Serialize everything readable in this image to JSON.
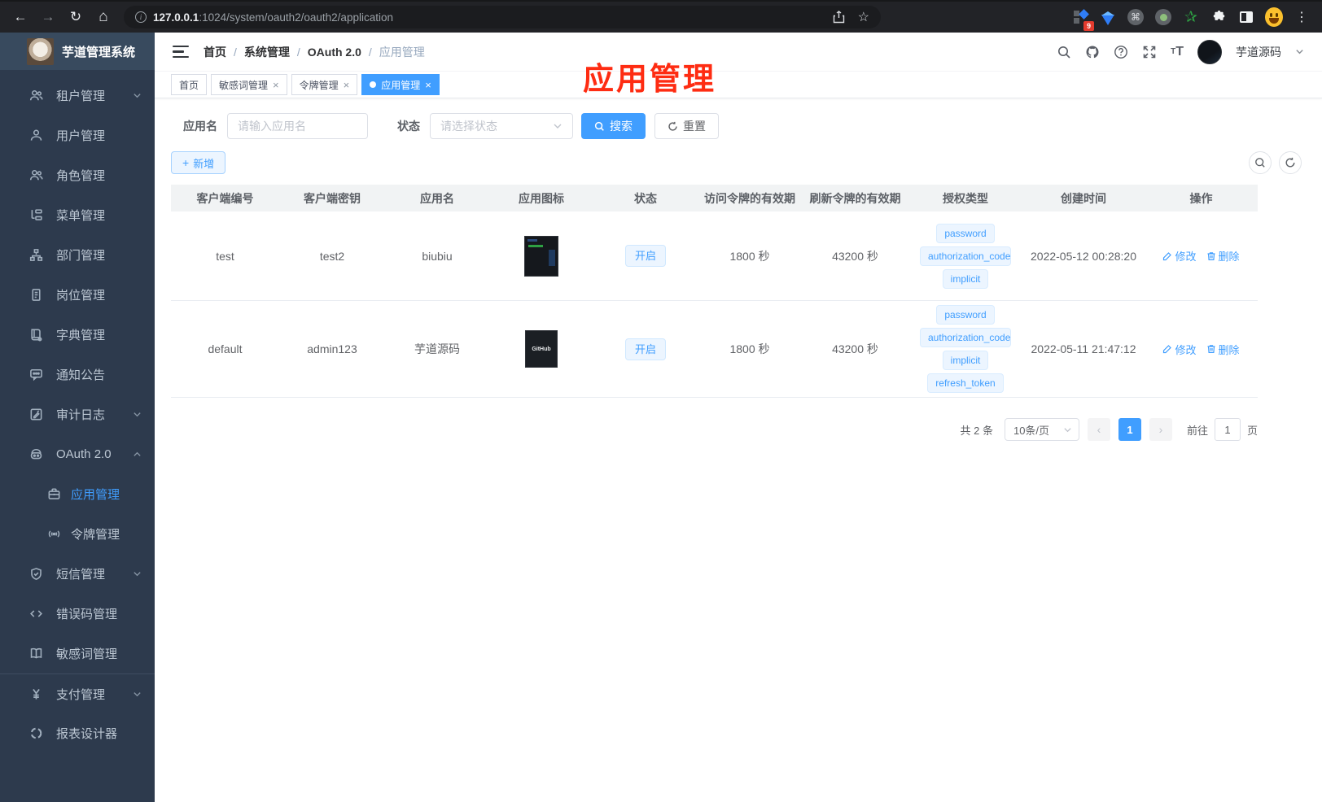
{
  "browser": {
    "url_host": "127.0.0.1",
    "url_rest": ":1024/system/oauth2/oauth2/application",
    "extension_badge": "9"
  },
  "annotation": {
    "text": "应用管理",
    "color": "#fe2c12"
  },
  "sidebar": {
    "logo_title": "芋道管理系统",
    "items": [
      {
        "label": "租户管理",
        "icon": "users-icon",
        "arrow": "down"
      },
      {
        "label": "用户管理",
        "icon": "user-icon"
      },
      {
        "label": "角色管理",
        "icon": "users-icon"
      },
      {
        "label": "菜单管理",
        "icon": "tree-icon"
      },
      {
        "label": "部门管理",
        "icon": "org-icon"
      },
      {
        "label": "岗位管理",
        "icon": "post-icon"
      },
      {
        "label": "字典管理",
        "icon": "dict-icon"
      },
      {
        "label": "通知公告",
        "icon": "message-icon"
      },
      {
        "label": "审计日志",
        "icon": "log-icon",
        "arrow": "down"
      },
      {
        "label": "OAuth 2.0",
        "icon": "robot-icon",
        "arrow": "up",
        "children": [
          {
            "label": "应用管理",
            "icon": "briefcase-icon",
            "active": true
          },
          {
            "label": "令牌管理",
            "icon": "token-icon"
          }
        ]
      },
      {
        "label": "短信管理",
        "icon": "shield-icon",
        "arrow": "down"
      },
      {
        "label": "错误码管理",
        "icon": "code-icon"
      },
      {
        "label": "敏感词管理",
        "icon": "book-icon"
      },
      {
        "label": "支付管理",
        "icon": "yen-icon",
        "arrow": "down"
      },
      {
        "label": "报表设计器",
        "icon": "report-icon"
      }
    ]
  },
  "header": {
    "breadcrumb": [
      "首页",
      "系统管理",
      "OAuth 2.0",
      "应用管理"
    ],
    "username": "芋道源码"
  },
  "tabs": [
    {
      "label": "首页",
      "closable": false,
      "active": false
    },
    {
      "label": "敏感词管理",
      "closable": true,
      "active": false
    },
    {
      "label": "令牌管理",
      "closable": true,
      "active": false
    },
    {
      "label": "应用管理",
      "closable": true,
      "active": true
    }
  ],
  "filters": {
    "app_name_label": "应用名",
    "app_name_placeholder": "请输入应用名",
    "status_label": "状态",
    "status_placeholder": "请选择状态",
    "search_button": "搜索",
    "reset_button": "重置"
  },
  "toolbar": {
    "add_button": "新增"
  },
  "table": {
    "columns": [
      "客户端编号",
      "客户端密钥",
      "应用名",
      "应用图标",
      "状态",
      "访问令牌的有效期",
      "刷新令牌的有效期",
      "授权类型",
      "创建时间",
      "操作"
    ],
    "actions": {
      "edit": "修改",
      "delete": "删除"
    },
    "rows": [
      {
        "client_id": "test",
        "secret": "test2",
        "name": "biubiu",
        "status": "开启",
        "access_ttl": "1800 秒",
        "refresh_ttl": "43200 秒",
        "grants": [
          "password",
          "authorization_code",
          "implicit"
        ],
        "created": "2022-05-12 00:28:20"
      },
      {
        "client_id": "default",
        "secret": "admin123",
        "name": "芋道源码",
        "icon_label": "GitHub",
        "status": "开启",
        "access_ttl": "1800 秒",
        "refresh_ttl": "43200 秒",
        "grants": [
          "password",
          "authorization_code",
          "implicit",
          "refresh_token"
        ],
        "created": "2022-05-11 21:47:12"
      }
    ]
  },
  "pagination": {
    "total": "共 2 条",
    "page_size": "10条/页",
    "current_page": "1",
    "goto_label": "前往",
    "goto_value": "1",
    "page_suffix": "页"
  },
  "colors": {
    "primary": "#409eff",
    "sidebar_bg": "#2d3a4d",
    "annotation_red": "#fe2c12"
  }
}
